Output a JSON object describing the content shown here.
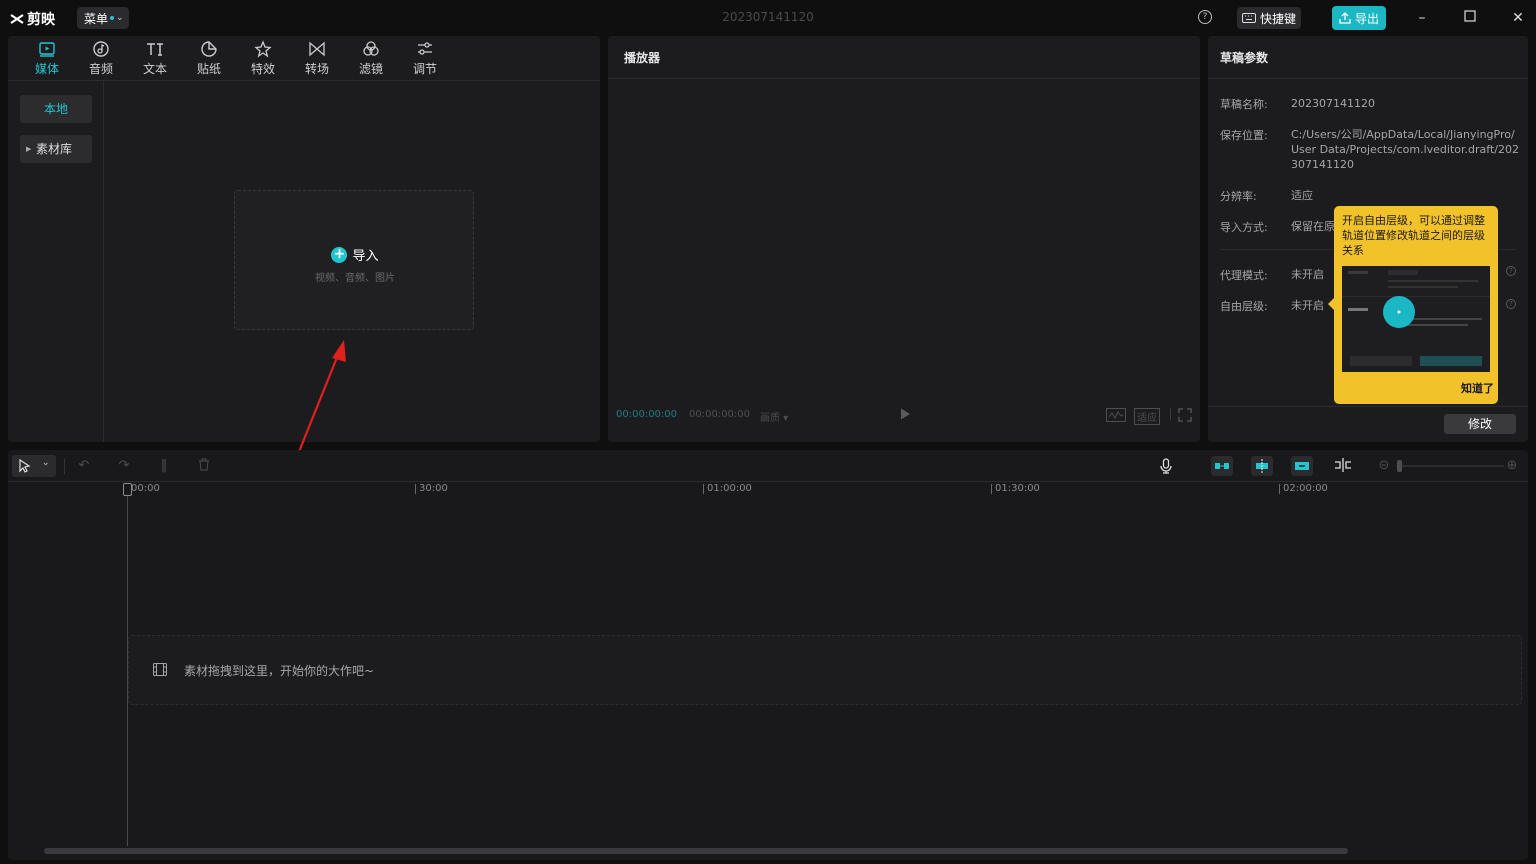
{
  "app": {
    "logo_text": "剪映",
    "menu_label": "菜单",
    "project_title": "202307141120"
  },
  "titlebar": {
    "help_icon": "?",
    "shortcut_label": "快捷键",
    "export_label": "导出"
  },
  "media": {
    "tabs": [
      {
        "label": "媒体",
        "icon": "media-icon",
        "active": true
      },
      {
        "label": "音频",
        "icon": "audio-icon"
      },
      {
        "label": "文本",
        "icon": "text-icon"
      },
      {
        "label": "贴纸",
        "icon": "sticker-icon"
      },
      {
        "label": "特效",
        "icon": "effects-icon"
      },
      {
        "label": "转场",
        "icon": "transition-icon"
      },
      {
        "label": "滤镜",
        "icon": "filter-icon"
      },
      {
        "label": "调节",
        "icon": "adjust-icon"
      }
    ],
    "sidebar": {
      "local": "本地",
      "library": "素材库"
    },
    "import": {
      "label": "导入",
      "hint": "视频、音频、图片"
    }
  },
  "player": {
    "title": "播放器",
    "current_time": "00:00:00:00",
    "total_time": "00:00:00:00",
    "quality": "画质",
    "fit": "适应"
  },
  "draft": {
    "title": "草稿参数",
    "name_label": "草稿名称:",
    "name_value": "202307141120",
    "path_label": "保存位置:",
    "path_value": "C:/Users/公司/AppData/Local/JianyingPro/User Data/Projects/com.lveditor.draft/202307141120",
    "resolution_label": "分辨率:",
    "resolution_value": "适应",
    "import_label": "导入方式:",
    "import_value": "保留在原",
    "proxy_label": "代理模式:",
    "proxy_value": "未开启",
    "layer_label": "自由层级:",
    "layer_value": "未开启",
    "modify_button": "修改"
  },
  "tooltip": {
    "text": "开启自由层级，可以通过调整轨道位置修改轨道之间的层级关系",
    "ok_label": "知道了"
  },
  "timeline": {
    "ruler": [
      "00:00",
      "30:00",
      "01:00:00",
      "01:30:00",
      "02:00:00"
    ],
    "drop_hint": "素材拖拽到这里，开始你的大作吧~"
  },
  "colors": {
    "accent": "#23c5d1",
    "tooltip_bg": "#f2c22b",
    "arrow": "#e0201c"
  }
}
